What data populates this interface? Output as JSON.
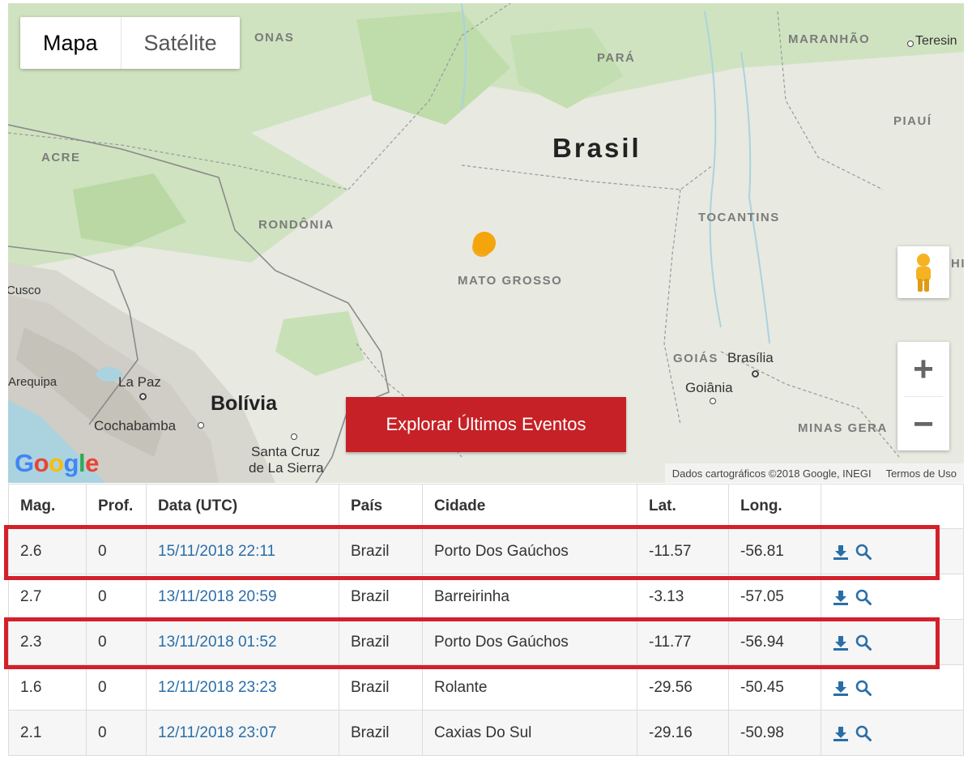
{
  "map": {
    "type_buttons": [
      "Mapa",
      "Satélite"
    ],
    "active_type": "Mapa",
    "labels": {
      "amazonas_partial": "ONAS",
      "para": "PARÁ",
      "maranhao": "MARANHÃO",
      "teresina": "Teresin",
      "acre": "ACRE",
      "piaui": "PIAUÍ",
      "brasil": "Brasil",
      "rondonia": "RONDÔNIA",
      "tocantins": "TOCANTINS",
      "mato_grosso": "MATO GROSSO",
      "cusco": "Cusco",
      "goias": "GOIÁS",
      "brasilia": "Brasília",
      "goiania": "Goiânia",
      "arequipa": "Arequipa",
      "la_paz": "La Paz",
      "bolivia": "Bolívia",
      "cochabamba": "Cochabamba",
      "santa_cruz_1": "Santa Cruz",
      "santa_cruz_2": "de La Sierra",
      "minas_gerais": "MINAS GERA",
      "bahia_partial": "HI"
    },
    "explore_button": "Explorar Últimos Eventos",
    "zoom_in": "+",
    "zoom_out": "−",
    "google_logo": "Google",
    "attribution": "Dados cartográficos ©2018 Google, INEGI",
    "terms": "Termos de Uso",
    "colors": {
      "marker": "#f5a40c",
      "explore_bg": "#c62127",
      "highlight": "#d3202a"
    }
  },
  "table": {
    "headers": [
      "Mag.",
      "Prof.",
      "Data (UTC)",
      "País",
      "Cidade",
      "Lat.",
      "Long.",
      ""
    ],
    "rows": [
      {
        "mag": "2.6",
        "prof": "0",
        "date": "15/11/2018 22:11",
        "pais": "Brazil",
        "cidade": "Porto Dos Gaúchos",
        "lat": "-11.57",
        "long": "-56.81",
        "highlighted": true
      },
      {
        "mag": "2.7",
        "prof": "0",
        "date": "13/11/2018 20:59",
        "pais": "Brazil",
        "cidade": "Barreirinha",
        "lat": "-3.13",
        "long": "-57.05",
        "highlighted": false
      },
      {
        "mag": "2.3",
        "prof": "0",
        "date": "13/11/2018 01:52",
        "pais": "Brazil",
        "cidade": "Porto Dos Gaúchos",
        "lat": "-11.77",
        "long": "-56.94",
        "highlighted": true
      },
      {
        "mag": "1.6",
        "prof": "0",
        "date": "12/11/2018 23:23",
        "pais": "Brazil",
        "cidade": "Rolante",
        "lat": "-29.56",
        "long": "-50.45",
        "highlighted": false
      },
      {
        "mag": "2.1",
        "prof": "0",
        "date": "12/11/2018 23:07",
        "pais": "Brazil",
        "cidade": "Caxias Do Sul",
        "lat": "-29.16",
        "long": "-50.98",
        "highlighted": false
      }
    ],
    "row_icons": [
      "download-icon",
      "search-icon"
    ]
  }
}
